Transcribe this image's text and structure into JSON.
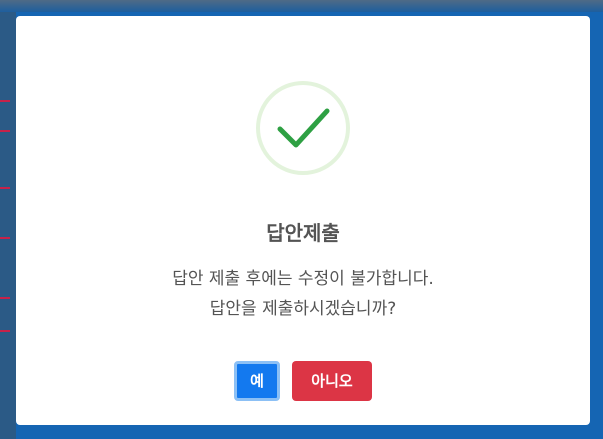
{
  "dialog": {
    "icon": "checkmark-success-icon",
    "title": "답안제출",
    "message_line1": "답안 제출 후에는 수정이 불가합니다.",
    "message_line2": "답안을 제출하시겠습니까?",
    "confirm_label": "예",
    "cancel_label": "아니오"
  },
  "colors": {
    "backdrop": "#1565b3",
    "success_ring": "#e3f3dc",
    "success_check": "#2ea043",
    "confirm_button": "#1379ef",
    "cancel_button": "#dc3545",
    "text": "#545454"
  }
}
